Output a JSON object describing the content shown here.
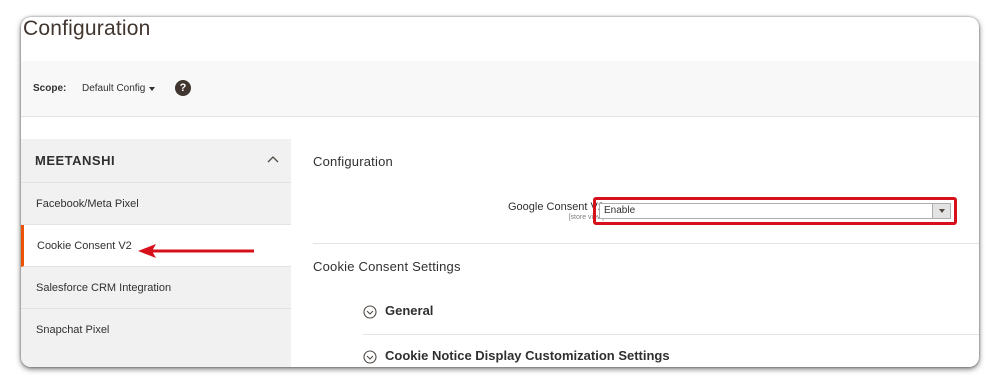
{
  "page": {
    "title": "Configuration"
  },
  "scope": {
    "label": "Scope:",
    "value": "Default Config",
    "help_symbol": "?"
  },
  "sidebar": {
    "brand": "MEETANSHI",
    "items": [
      {
        "label": "Facebook/Meta Pixel"
      },
      {
        "label": "Cookie Consent V2"
      },
      {
        "label": "Salesforce CRM Integration"
      },
      {
        "label": "Snapchat Pixel"
      }
    ]
  },
  "main": {
    "section_title": "Configuration",
    "field": {
      "label": "Google Consent V2",
      "scope": "[store view]",
      "value": "Enable"
    },
    "settings_title": "Cookie Consent Settings",
    "groups": [
      {
        "label": "General"
      },
      {
        "label": "Cookie Notice Display Customization Settings"
      }
    ]
  },
  "colors": {
    "active_border": "#eb5202",
    "highlight": "#d7111b",
    "sidebar_bg": "#f1f1f1"
  }
}
